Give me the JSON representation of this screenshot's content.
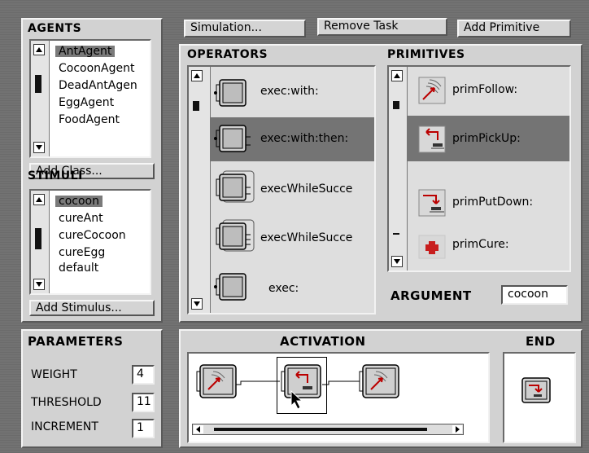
{
  "agents": {
    "heading": "AGENTS",
    "items": [
      "AntAgent",
      "CocoonAgent",
      "DeadAntAgen",
      "EggAgent",
      "FoodAgent"
    ],
    "selected": "AntAgent",
    "add_button": "Add Class..."
  },
  "stimuli": {
    "heading": "STIMULI",
    "items": [
      "cocoon",
      "cureAnt",
      "cureCocoon",
      "cureEgg",
      "default"
    ],
    "selected": "cocoon",
    "add_button": "Add Stimulus..."
  },
  "toolbar": {
    "simulation": "Simulation...",
    "remove_task": "Remove Task",
    "add_primitive": "Add Primitive"
  },
  "operators": {
    "heading": "OPERATORS",
    "items": [
      "exec:with:",
      "exec:with:then:",
      "execWhileSucce",
      "execWhileSucce",
      "exec:"
    ],
    "selected": "exec:with:then:"
  },
  "primitives": {
    "heading": "PRIMITIVES",
    "items": [
      {
        "label": "primFollow:",
        "icon": "follow-icon"
      },
      {
        "label": "primPickUp:",
        "icon": "pickup-icon"
      },
      {
        "label": "primPutDown:",
        "icon": "putdown-icon"
      },
      {
        "label": "primCure:",
        "icon": "cure-icon"
      }
    ],
    "selected": "primPickUp:"
  },
  "argument": {
    "label": "ARGUMENT",
    "value": "cocoon"
  },
  "parameters": {
    "heading": "PARAMETERS",
    "rows": [
      {
        "label": "WEIGHT",
        "value": "4"
      },
      {
        "label": "THRESHOLD",
        "value": "11"
      },
      {
        "label": "INCREMENT",
        "value": "1"
      }
    ]
  },
  "activation": {
    "heading": "ACTIVATION"
  },
  "end": {
    "heading": "END"
  },
  "colors": {
    "selection": "#747474",
    "panel": "#d2d2d2",
    "cure_cross": "#c81e1e"
  }
}
